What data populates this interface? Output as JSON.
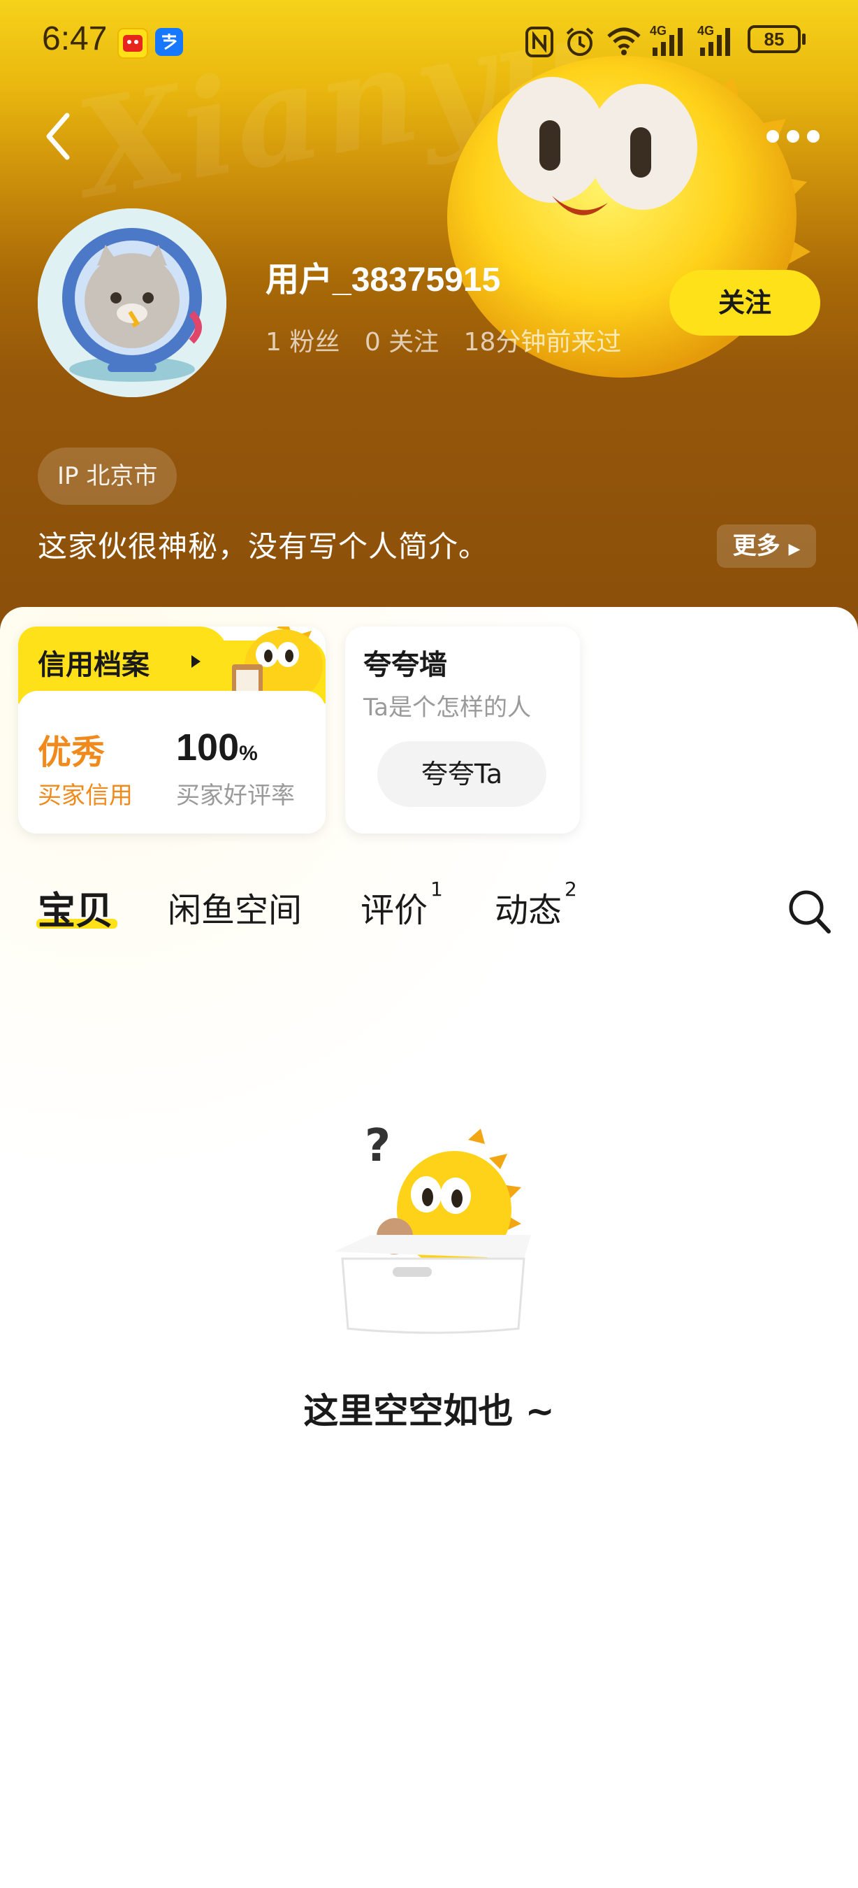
{
  "status_bar": {
    "time": "6:47",
    "battery": "85",
    "network_1": "4G",
    "network_2": "4G",
    "icons": [
      "xianyu-app-icon",
      "alipay-app-icon",
      "nfc-icon",
      "alarm-icon",
      "wifi-icon",
      "signal-icon",
      "signal-icon",
      "battery-icon"
    ]
  },
  "header": {
    "watermark": "Xianyu",
    "back_icon": "chevron-left-icon",
    "more_icon": "more-dots-icon"
  },
  "profile": {
    "username": "用户_38375915",
    "followers": "1 粉丝",
    "following": "0 关注",
    "last_seen": "18分钟前来过",
    "follow_label": "关注",
    "ip_label": "IP 北京市",
    "bio": "这家伙很神秘，没有写个人简介。",
    "more_label": "更多"
  },
  "credit": {
    "title": "信用档案",
    "level": "优秀",
    "level_label": "买家信用",
    "rate_value": "100",
    "rate_unit": "%",
    "rate_label": "买家好评率"
  },
  "praise": {
    "title": "夸夸墙",
    "subtitle": "Ta是个怎样的人",
    "button_label": "夸夸Ta"
  },
  "tabs": [
    {
      "label": "宝贝",
      "active": true
    },
    {
      "label": "闲鱼空间",
      "active": false
    },
    {
      "label": "评价",
      "badge": "1",
      "active": false
    },
    {
      "label": "动态",
      "badge": "2",
      "active": false
    }
  ],
  "empty_state": {
    "text": "这里空空如也 ~"
  },
  "colors": {
    "brand_yellow": "#ffe11a",
    "accent_orange": "#f08a1c",
    "header_top": "#f6d21a",
    "header_bottom": "#8b4f0a"
  }
}
